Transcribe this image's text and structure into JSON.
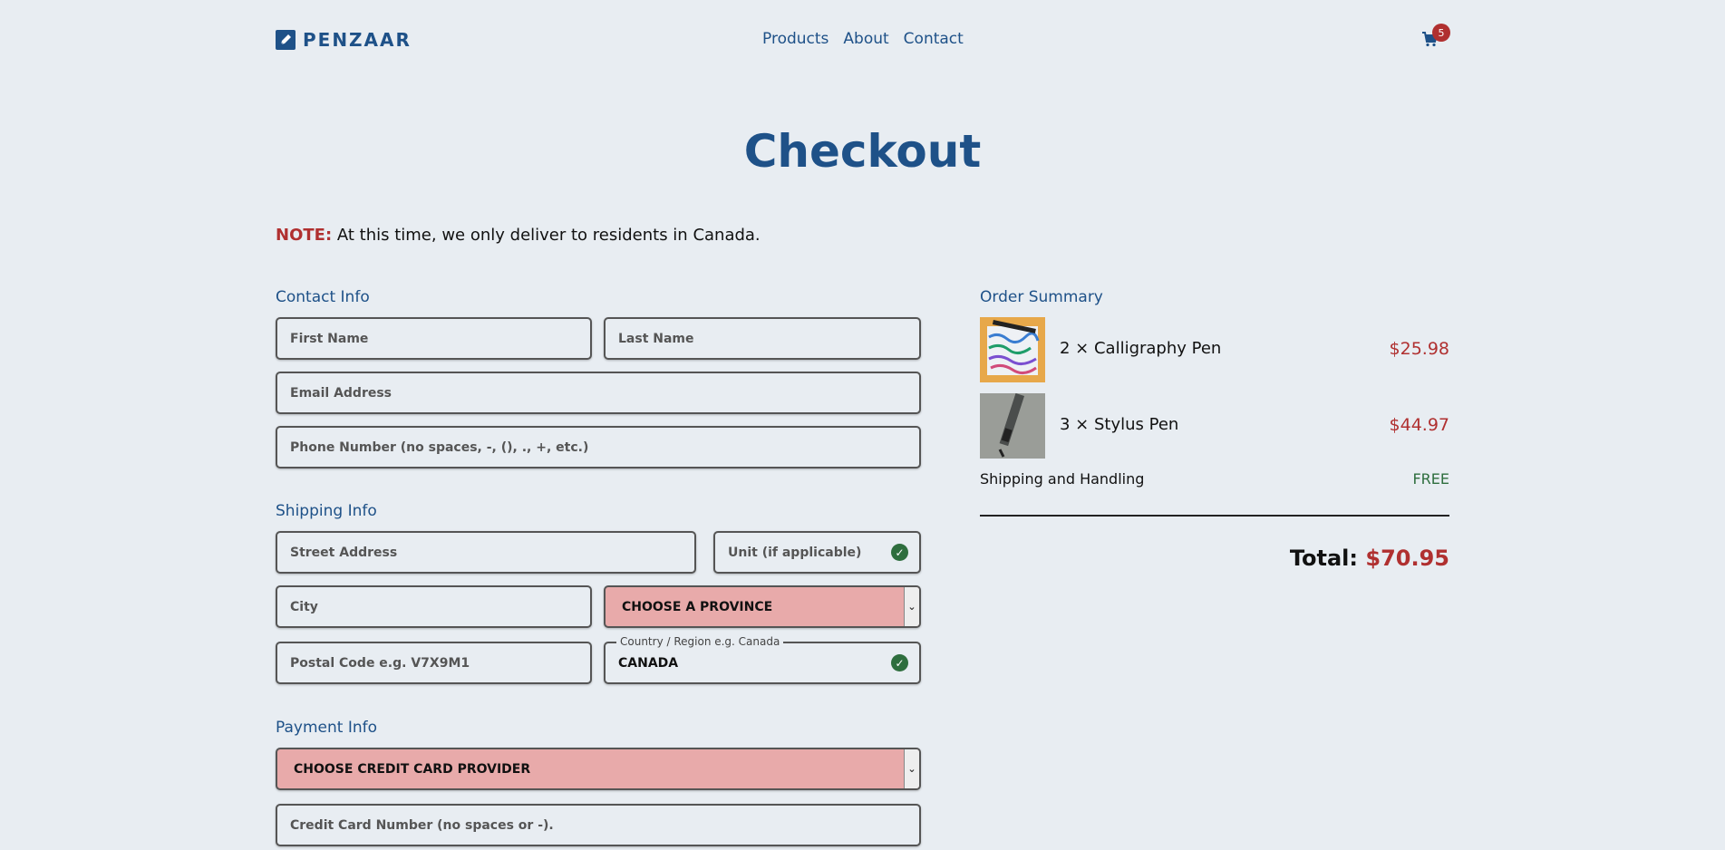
{
  "brand": {
    "name": "PENZAAR"
  },
  "nav": {
    "products": "Products",
    "about": "About",
    "contact": "Contact"
  },
  "cart": {
    "count": "5"
  },
  "page": {
    "title": "Checkout"
  },
  "note": {
    "label": "NOTE:",
    "text": "At this time, we only deliver to residents in Canada."
  },
  "contact_info": {
    "title": "Contact Info",
    "first_name": "First Name",
    "last_name": "Last Name",
    "email": "Email Address",
    "phone": "Phone Number (no spaces, -, (), ., +, etc.)"
  },
  "shipping_info": {
    "title": "Shipping Info",
    "street": "Street Address",
    "unit": "Unit (if applicable)",
    "city": "City",
    "province": "CHOOSE A PROVINCE",
    "postal": "Postal Code e.g. V7X9M1",
    "country_label": "Country / Region e.g. Canada",
    "country_value": "CANADA"
  },
  "payment_info": {
    "title": "Payment Info",
    "provider": "CHOOSE CREDIT CARD PROVIDER",
    "card_number": "Credit Card Number (no spaces or -)."
  },
  "order_summary": {
    "title": "Order Summary",
    "items": [
      {
        "name": "2 × Calligraphy Pen",
        "price": "$25.98"
      },
      {
        "name": "3 × Stylus Pen",
        "price": "$44.97"
      }
    ],
    "shipping_label": "Shipping and Handling",
    "shipping_value": "FREE",
    "total_label": "Total:",
    "total_value": "$70.95"
  },
  "colors": {
    "brand": "#1e5188",
    "accent_red": "#b03030",
    "success": "#2e6e3e",
    "select_bg": "#e8aaaa"
  }
}
